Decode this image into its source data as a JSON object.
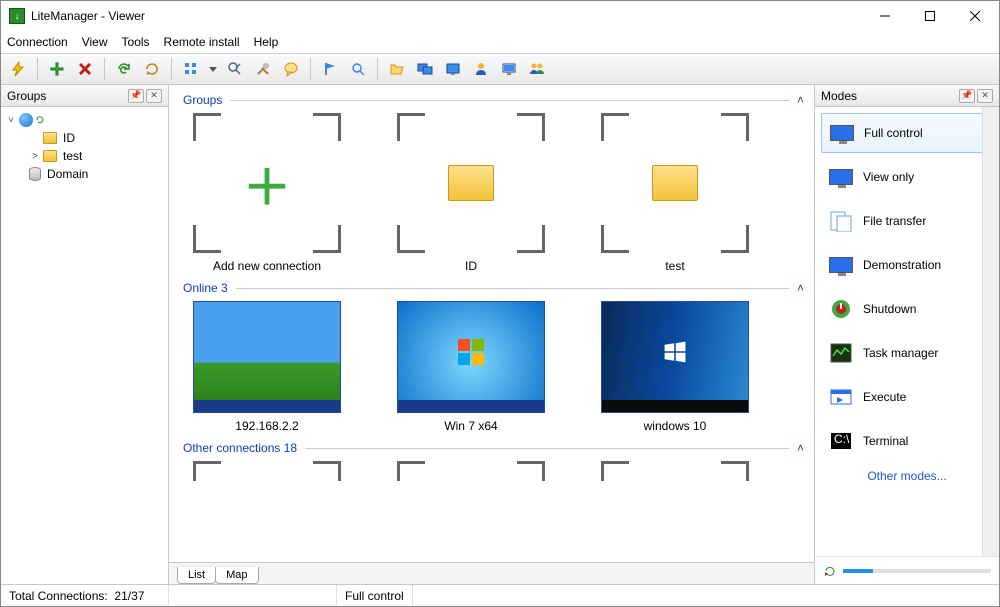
{
  "window": {
    "title": "LiteManager - Viewer"
  },
  "menu": {
    "connection": "Connection",
    "view": "View",
    "tools": "Tools",
    "remote_install": "Remote install",
    "help": "Help"
  },
  "panels": {
    "left_title": "Groups",
    "right_title": "Modes"
  },
  "tree": {
    "root_expander": "˅",
    "items": [
      {
        "label": "ID"
      },
      {
        "label": "test",
        "expander": ">"
      },
      {
        "label": "Domain"
      }
    ]
  },
  "sections": {
    "groups": {
      "title": "Groups",
      "items": [
        {
          "label": "Add new connection"
        },
        {
          "label": "ID"
        },
        {
          "label": "test"
        }
      ]
    },
    "online": {
      "title": "Online 3",
      "items": [
        {
          "label": "192.168.2.2"
        },
        {
          "label": "Win 7 x64"
        },
        {
          "label": "windows 10"
        }
      ]
    },
    "other": {
      "title": "Other connections 18"
    }
  },
  "tabs": {
    "list": "List",
    "map": "Map"
  },
  "modes": {
    "items": [
      {
        "label": "Full control"
      },
      {
        "label": "View only"
      },
      {
        "label": "File transfer"
      },
      {
        "label": "Demonstration"
      },
      {
        "label": "Shutdown"
      },
      {
        "label": "Task manager"
      },
      {
        "label": "Execute"
      },
      {
        "label": "Terminal"
      }
    ],
    "more": "Other modes..."
  },
  "status": {
    "total_label": "Total Connections:",
    "total_value": "21/37",
    "mode": "Full control"
  }
}
